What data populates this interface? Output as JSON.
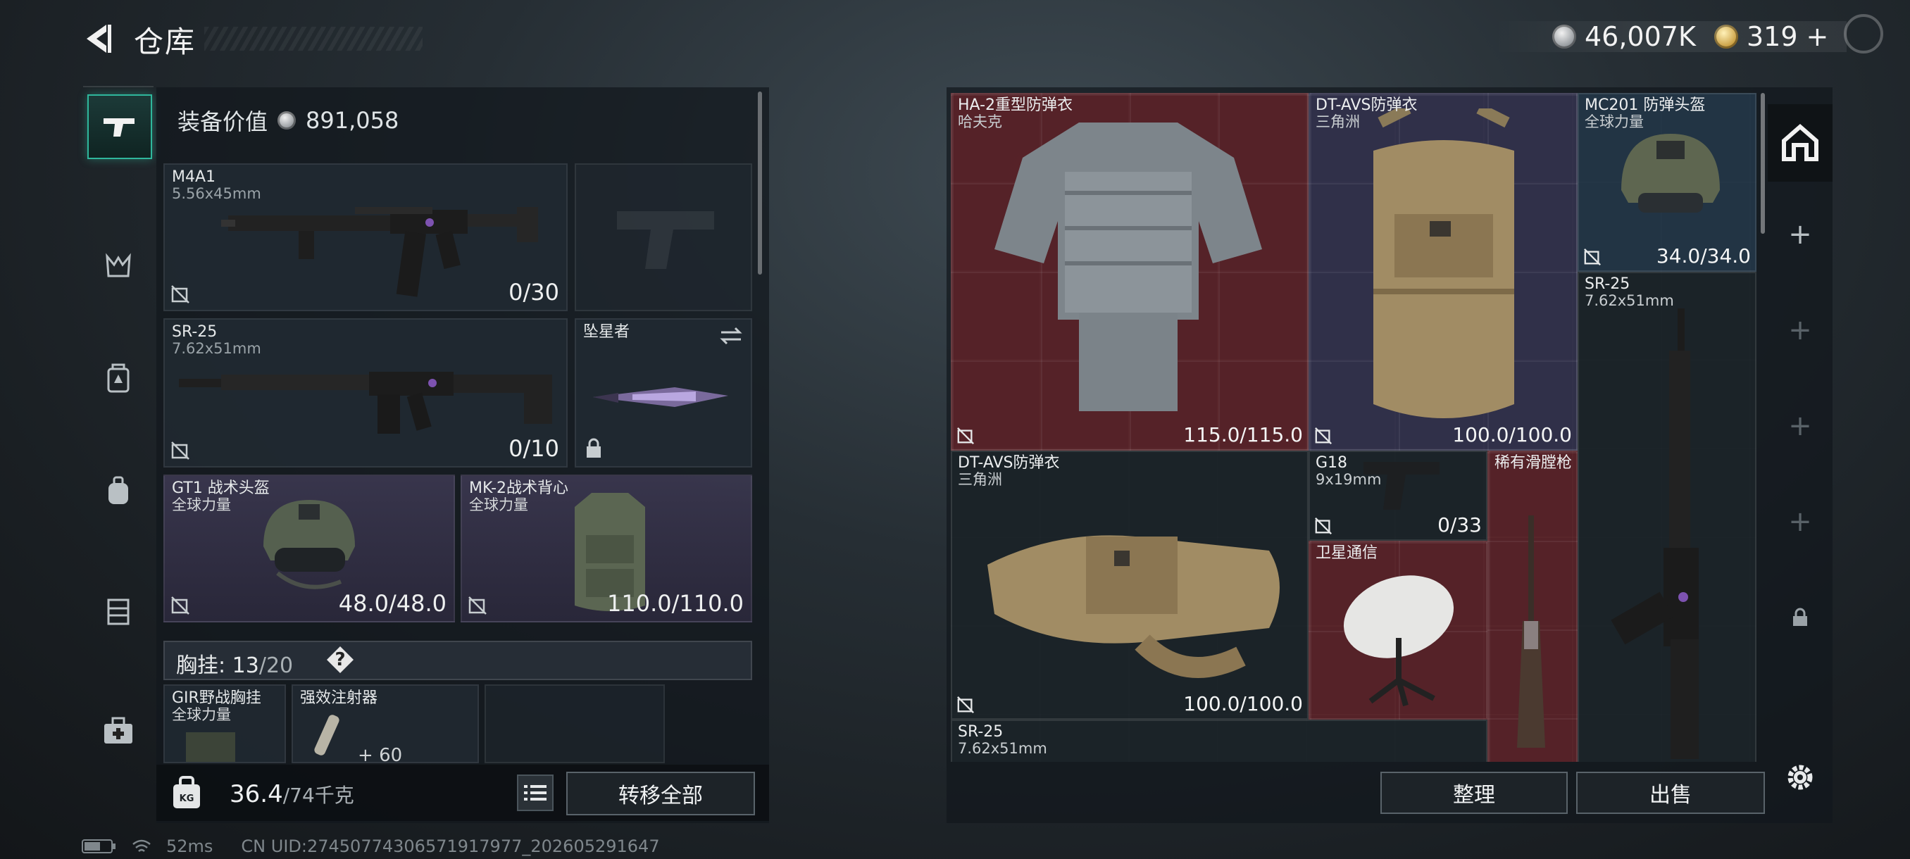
{
  "header": {
    "title": "仓库",
    "currency_silver": "46,007K",
    "currency_gold": "319",
    "add_label": "+"
  },
  "tabs": [
    {
      "name": "weapons",
      "icon": "pistol-icon",
      "active": true
    },
    {
      "name": "helmet",
      "icon": "helmet-icon",
      "active": false
    },
    {
      "name": "armor",
      "icon": "armor-icon",
      "active": false
    },
    {
      "name": "backpack",
      "icon": "backpack-icon",
      "active": false
    },
    {
      "name": "chest-rig",
      "icon": "chest-rig-icon",
      "active": false
    },
    {
      "name": "medical",
      "icon": "medkit-icon",
      "active": false
    }
  ],
  "loadout": {
    "value_label": "装备价值",
    "value": "891,058",
    "primary": {
      "name": "M4A1",
      "caliber": "5.56x45mm",
      "ammo": "0/30"
    },
    "secondary": {
      "name": "SR-25",
      "caliber": "7.62x51mm",
      "ammo": "0/10"
    },
    "melee": {
      "name": "坠星者"
    },
    "helmet": {
      "name": "GT1 战术头盔",
      "brand": "全球力量",
      "durability": "48.0/48.0"
    },
    "armor": {
      "name": "MK-2战术背心",
      "brand": "全球力量",
      "durability": "110.0/110.0"
    },
    "chest_rig": {
      "label": "胸挂:",
      "used": "13",
      "capacity": "/20",
      "help": "?"
    },
    "rig_items": [
      {
        "name": "GIR野战胸挂",
        "brand": "全球力量"
      },
      {
        "name": "强效注射器",
        "count": "60"
      }
    ],
    "weight": {
      "current": "36.4",
      "max": "/74千克",
      "icon_text": "KG"
    },
    "transfer_all": "转移全部"
  },
  "stash": {
    "items": [
      {
        "name": "HA-2重型防弹衣",
        "brand": "哈夫克",
        "value": "115.0/115.0"
      },
      {
        "name": "DT-AVS防弹衣",
        "brand": "三角洲",
        "value": "100.0/100.0"
      },
      {
        "name": "MC201 防弹头盔",
        "brand": "全球力量",
        "value": "34.0/34.0"
      },
      {
        "name": "SR-25",
        "caliber": "7.62x51mm"
      },
      {
        "name": "DT-AVS防弹衣",
        "brand": "三角洲",
        "value": "100.0/100.0"
      },
      {
        "name": "G18",
        "caliber": "9x19mm",
        "value": "0/33"
      },
      {
        "name": "稀有滑膛枪"
      },
      {
        "name": "卫星通信"
      },
      {
        "name": "SR-25",
        "caliber": "7.62x51mm"
      }
    ],
    "tidy": "整理",
    "sell": "出售"
  },
  "side_panel": {
    "plus": "+"
  },
  "status": {
    "ping": "52ms",
    "uid": "CN UID:274507743065719179​77_202605291647"
  }
}
